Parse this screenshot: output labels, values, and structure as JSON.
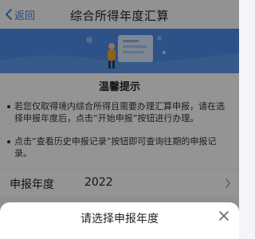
{
  "nav": {
    "back_label": "返回",
    "title": "综合所得年度汇算"
  },
  "tips": {
    "title": "温馨提示",
    "items": [
      "若您仅取得境内综合所得且需要办理汇算申报，请在选择申报年度后，点击“开始申报”按钮进行办理。",
      "点击“查看历史申报记录”按钮即可查询往期的申报记录。"
    ]
  },
  "year_row": {
    "label": "申报年度",
    "value": "2022"
  },
  "sheet": {
    "title": "请选择申报年度"
  },
  "colors": {
    "accent": "#3b82e6",
    "banner": "#4a8ce9",
    "mask": "rgba(0,0,0,0.42)"
  }
}
